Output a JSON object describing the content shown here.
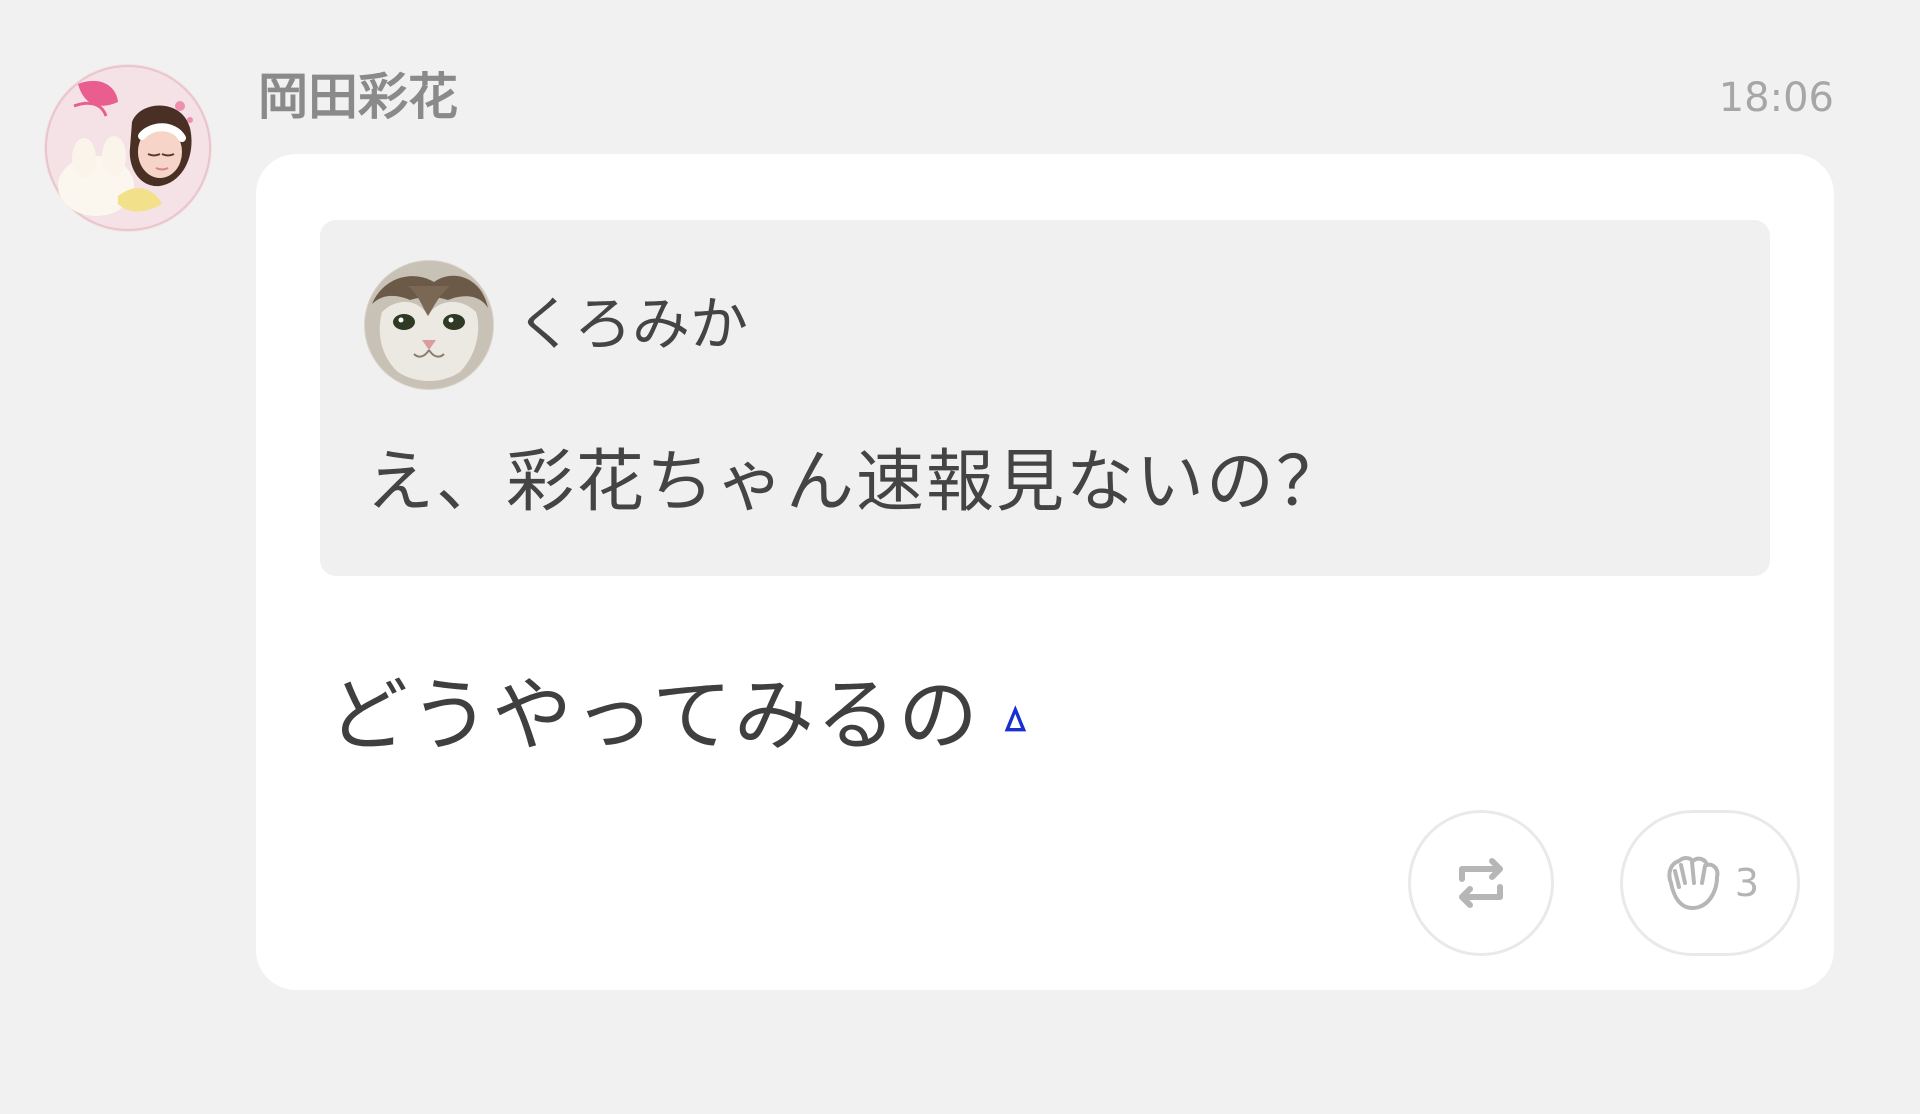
{
  "message": {
    "sender_name": "岡田彩花",
    "timestamp": "18:06",
    "text": "どうやってみるの",
    "emoji": "ㅿ"
  },
  "quote": {
    "author": "くろみか",
    "text": "え、彩花ちゃん速報見ないの？"
  },
  "actions": {
    "repost_icon": "repost-icon",
    "clap_icon": "clap-icon",
    "clap_count": "3"
  },
  "colors": {
    "background": "#f1f1f1",
    "bubble": "#ffffff",
    "quote_background": "#f0f0f0",
    "emoji_blue": "#1a2fd0",
    "muted_text": "#a6a6a6"
  }
}
